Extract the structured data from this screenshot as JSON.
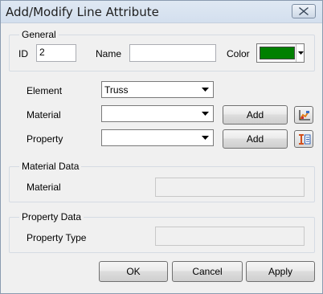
{
  "window": {
    "title": "Add/Modify Line Attribute"
  },
  "general": {
    "legend": "General",
    "id_label": "ID",
    "id_value": "2",
    "name_label": "Name",
    "name_value": "",
    "color_label": "Color",
    "color_value": "#008000"
  },
  "element": {
    "label": "Element",
    "selected": "Truss"
  },
  "material": {
    "label": "Material",
    "selected": "",
    "add_label": "Add",
    "icon": "material-chart-icon"
  },
  "property": {
    "label": "Property",
    "selected": "",
    "add_label": "Add",
    "icon": "property-section-icon"
  },
  "material_data": {
    "legend": "Material Data",
    "field_label": "Material",
    "field_value": ""
  },
  "property_data": {
    "legend": "Property Data",
    "field_label": "Property Type",
    "field_value": ""
  },
  "footer": {
    "ok_label": "OK",
    "cancel_label": "Cancel",
    "apply_label": "Apply"
  }
}
